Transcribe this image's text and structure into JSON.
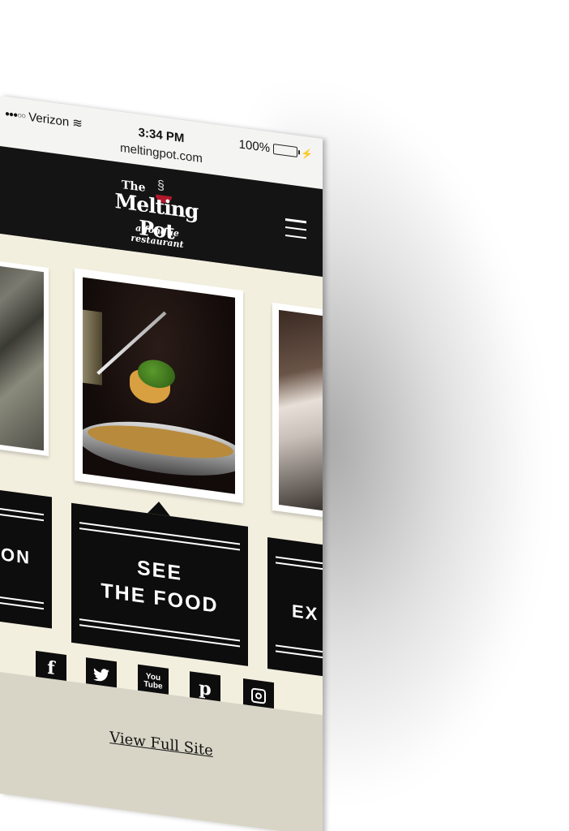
{
  "status_bar": {
    "carrier": "Verizon",
    "signal_dots": "●●●○○",
    "time": "3:34 PM",
    "url": "meltingpot.com",
    "battery": "100%",
    "battery_level": 1.0
  },
  "header": {
    "logo_the": "The",
    "logo_name": "Melting Pot",
    "logo_tagline": "a fondue restaurant",
    "menu_icon": "hamburger-icon"
  },
  "carousel": {
    "cards": [
      {
        "name": "aerial-city-photo"
      },
      {
        "name": "fondue-broccoli-photo"
      },
      {
        "name": "chef-photo"
      }
    ]
  },
  "panels": {
    "left_text": "ON",
    "center_line1": "SEE",
    "center_line2": "THE FOOD",
    "right_text": "EX"
  },
  "social": {
    "facebook": "f",
    "twitter": "🐦",
    "youtube_top": "You",
    "youtube_bottom": "Tube",
    "pinterest": "p",
    "instagram": "instagram-icon"
  },
  "footer": {
    "full_site_link": "View Full Site"
  },
  "colors": {
    "header_bg": "#141414",
    "cream": "#f3efdf",
    "footer_bg": "#d8d5c6",
    "logo_red": "#b0182c",
    "battery_green": "#4cd964"
  }
}
